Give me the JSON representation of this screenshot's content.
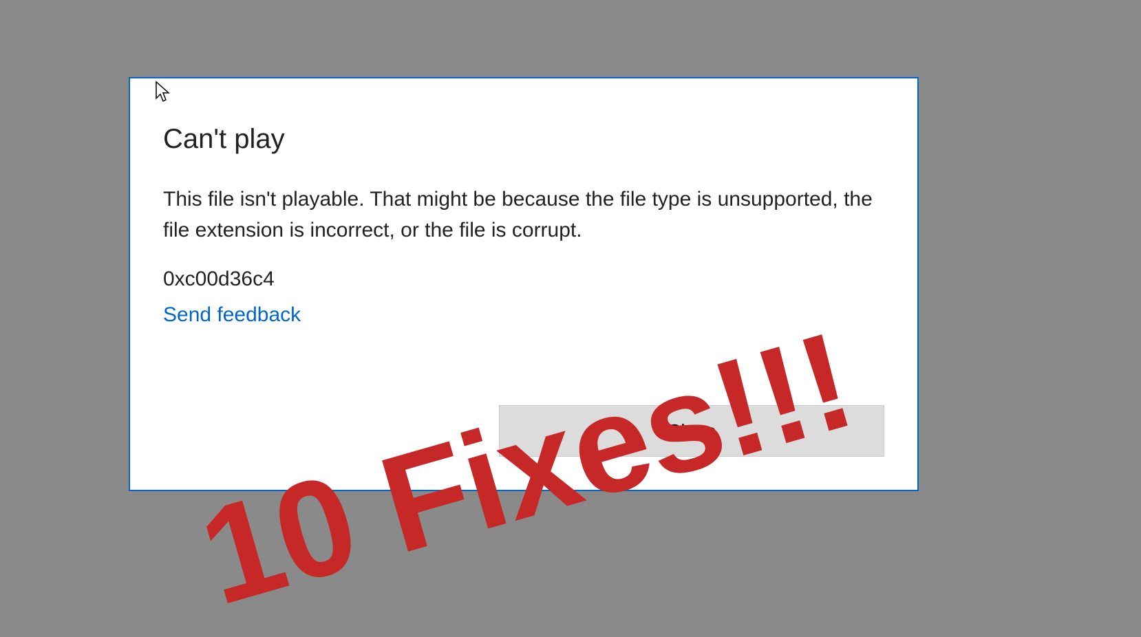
{
  "dialog": {
    "title": "Can't play",
    "message": "This file isn't playable. That might be because the file type is unsupported, the file extension is incorrect, or the file is corrupt.",
    "error_code": "0xc00d36c4",
    "feedback_link": "Send feedback",
    "close_button": "Close"
  },
  "overlay": {
    "text": "10 Fixes!!!"
  }
}
